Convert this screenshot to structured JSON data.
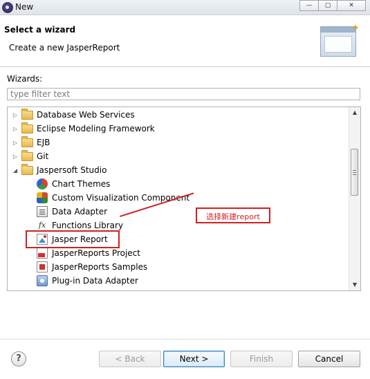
{
  "window": {
    "title": "New",
    "controls": {
      "minimize": "—",
      "maximize": "▢",
      "close": "✕"
    }
  },
  "header": {
    "title": "Select a wizard",
    "description": "Create a new JasperReport",
    "banner_icon": "new-wizard-banner-icon"
  },
  "wizards": {
    "label": "Wizards:",
    "filter_placeholder": "type filter text",
    "filter_value": ""
  },
  "tree": {
    "items": [
      {
        "label": "Database Web Services",
        "type": "folder",
        "expanded": false,
        "icon": "folder-icon"
      },
      {
        "label": "Eclipse Modeling Framework",
        "type": "folder",
        "expanded": false,
        "icon": "folder-icon"
      },
      {
        "label": "EJB",
        "type": "folder",
        "expanded": false,
        "icon": "folder-icon"
      },
      {
        "label": "Git",
        "type": "folder",
        "expanded": false,
        "icon": "folder-icon"
      },
      {
        "label": "Jaspersoft Studio",
        "type": "folder",
        "expanded": true,
        "icon": "folder-icon"
      },
      {
        "label": "Chart Themes",
        "type": "item",
        "icon": "chart-themes-icon"
      },
      {
        "label": "Custom Visualization Component",
        "type": "item",
        "icon": "custom-visualization-icon"
      },
      {
        "label": "Data Adapter",
        "type": "item",
        "icon": "data-adapter-icon"
      },
      {
        "label": "Functions Library",
        "type": "item",
        "icon": "functions-library-icon"
      },
      {
        "label": "Jasper Report",
        "type": "item",
        "icon": "jasper-report-icon"
      },
      {
        "label": "JasperReports Project",
        "type": "item",
        "icon": "jasperreports-project-icon"
      },
      {
        "label": "JasperReports Samples",
        "type": "item",
        "icon": "jasperreports-samples-icon"
      },
      {
        "label": "Plug-in Data Adapter",
        "type": "item",
        "icon": "plugin-data-adapter-icon"
      }
    ]
  },
  "annotation": {
    "text": "选择新建report",
    "color": "#d02020"
  },
  "footer": {
    "help": "?",
    "back_label": "< Back",
    "next_label": "Next >",
    "finish_label": "Finish",
    "cancel_label": "Cancel"
  }
}
